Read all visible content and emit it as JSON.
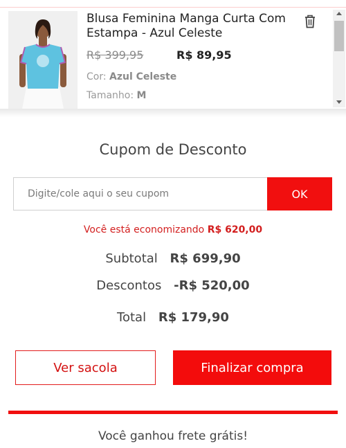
{
  "product": {
    "title": "Blusa Feminina Manga Curta Com Estampa - Azul Celeste",
    "old_price": "R$ 399,95",
    "new_price": "R$ 89,95",
    "color_label": "Cor:",
    "color_value": "Azul Celeste",
    "size_label": "Tamanho:",
    "size_value": "M",
    "remove_icon": "trash-icon"
  },
  "coupon": {
    "title": "Cupom de Desconto",
    "placeholder": "Digite/cole aqui o seu cupom",
    "value": "",
    "button_label": "OK"
  },
  "savings": {
    "text": "Você está economizando",
    "amount": "R$ 620,00"
  },
  "summary": {
    "subtotal_label": "Subtotal",
    "subtotal_value": "R$ 699,90",
    "discount_label": "Descontos",
    "discount_value": "-R$ 520,00",
    "total_label": "Total",
    "total_value": "R$ 179,90"
  },
  "actions": {
    "view_bag_label": "Ver sacola",
    "checkout_label": "Finalizar compra"
  },
  "shipping": {
    "progress_fraction": 1.0,
    "message": "Você ganhou frete grátis!"
  },
  "colors": {
    "accent": "#f10f0f",
    "savings_text": "#d31f1f"
  }
}
